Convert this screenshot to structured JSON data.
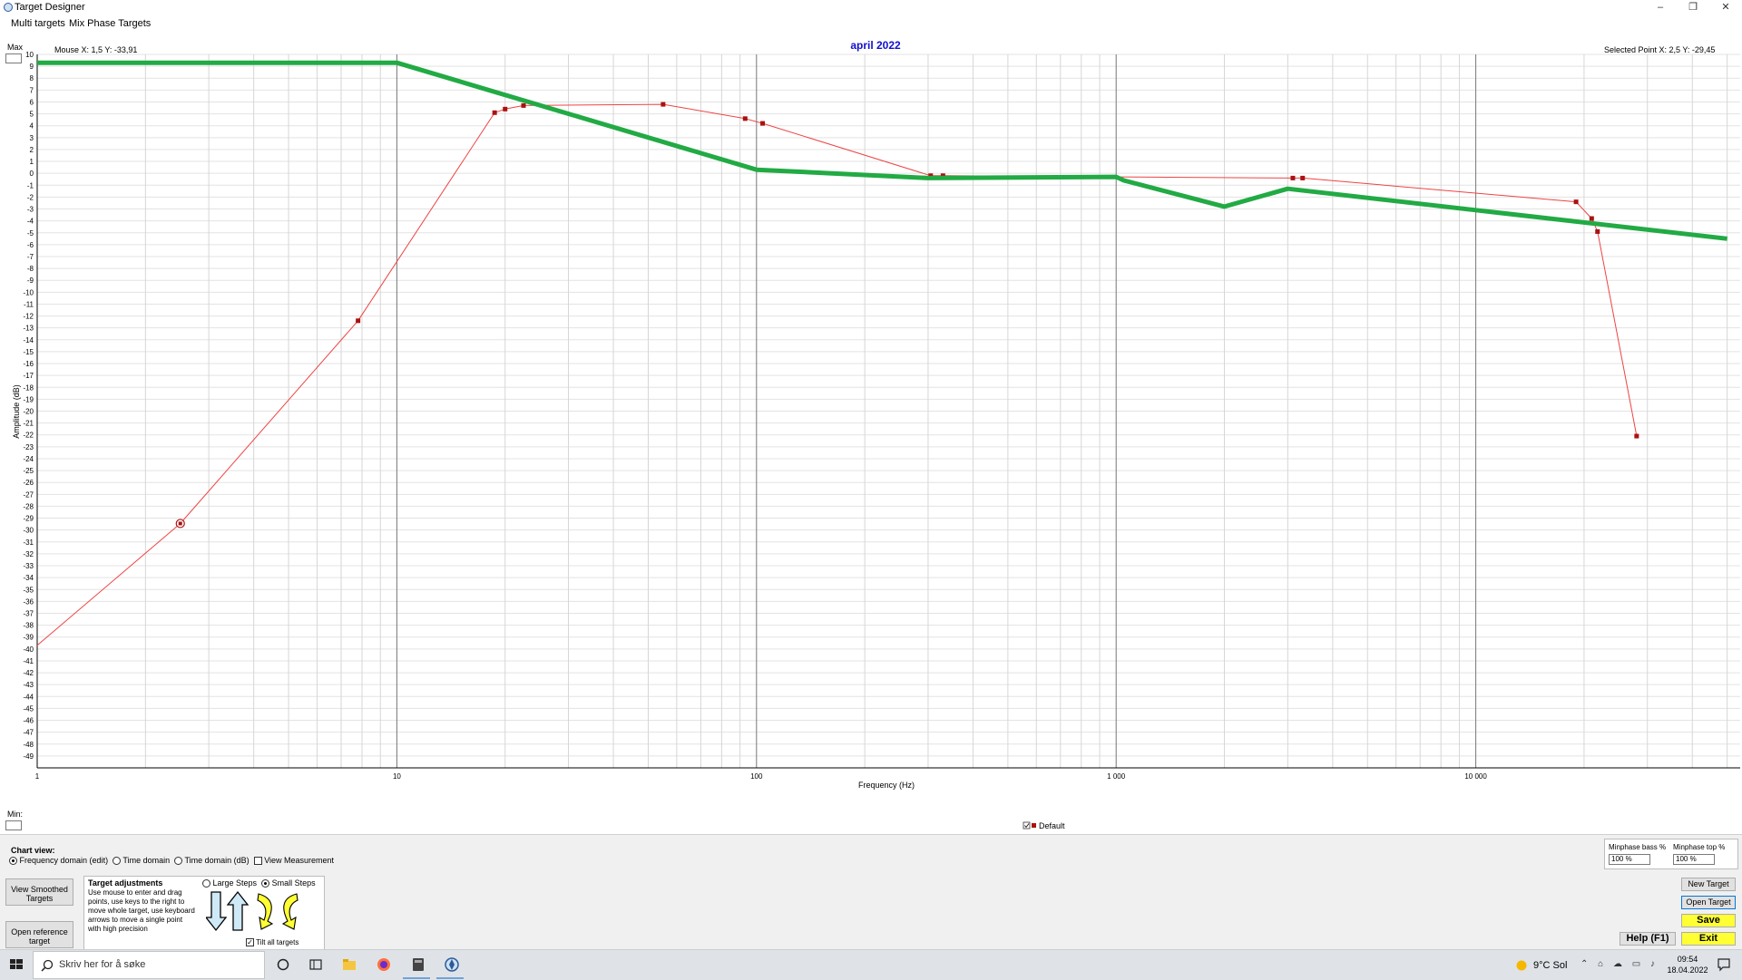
{
  "window": {
    "title": "Target Designer",
    "minimize": "–",
    "restore": "❐",
    "close": "✕"
  },
  "menu": [
    "Multi targets",
    "Mix Phase Targets"
  ],
  "chart_header": {
    "max_label": "Max",
    "min_label": "Min:",
    "mouse": "Mouse  X: 1,5   Y: -33,91",
    "selected": "Selected Point   X: 2,5   Y: -29,45"
  },
  "chart_data": {
    "type": "line",
    "title": "april 2022",
    "xlabel": "Frequency (Hz)",
    "ylabel": "Amplitude (dB)",
    "xscale": "log",
    "xlim": [
      1,
      50000
    ],
    "ylim": [
      -50,
      10
    ],
    "xticks": [
      {
        "v": 1,
        "label": "1"
      },
      {
        "v": 10,
        "label": "10"
      },
      {
        "v": 100,
        "label": "100"
      },
      {
        "v": 1000,
        "label": "1 000"
      },
      {
        "v": 10000,
        "label": "10 000"
      }
    ],
    "yticks": [
      10,
      9,
      8,
      7,
      6,
      5,
      4,
      3,
      2,
      1,
      0,
      -1,
      -2,
      -3,
      -4,
      -5,
      -6,
      -7,
      -8,
      -9,
      -10,
      -11,
      -12,
      -13,
      -14,
      -15,
      -16,
      -17,
      -18,
      -19,
      -20,
      -21,
      -22,
      -23,
      -24,
      -25,
      -26,
      -27,
      -28,
      -29,
      -30,
      -31,
      -32,
      -33,
      -34,
      -35,
      -36,
      -37,
      -38,
      -39,
      -40,
      -41,
      -42,
      -43,
      -44,
      -45,
      -46,
      -47,
      -48,
      -49
    ],
    "grid": true,
    "legend": {
      "position": "bottom",
      "entries": [
        "Default"
      ]
    },
    "series": [
      {
        "name": "Default",
        "color": "#ee4444",
        "marker": "square",
        "points": [
          [
            1,
            -39.7
          ],
          [
            2.5,
            -29.45
          ],
          [
            7.8,
            -12.4
          ],
          [
            18.7,
            5.1
          ],
          [
            20,
            5.4
          ],
          [
            22.5,
            5.7
          ],
          [
            55,
            5.8
          ],
          [
            93,
            4.6
          ],
          [
            104,
            4.2
          ],
          [
            305,
            -0.2
          ],
          [
            330,
            -0.2
          ],
          [
            3100,
            -0.4
          ],
          [
            3300,
            -0.4
          ],
          [
            19000,
            -2.4
          ],
          [
            21000,
            -3.8
          ],
          [
            21800,
            -4.9
          ],
          [
            28000,
            -22.1
          ]
        ],
        "selected_index": 1
      },
      {
        "color": "#22aa44",
        "marker": "none",
        "points": [
          [
            1,
            9.3
          ],
          [
            10,
            9.3
          ],
          [
            100,
            0.3
          ],
          [
            300,
            -0.4
          ],
          [
            1000,
            -0.3
          ],
          [
            1050,
            -0.6
          ],
          [
            2000,
            -2.8
          ],
          [
            3000,
            -1.3
          ],
          [
            10000,
            -3.1
          ],
          [
            50000,
            -5.5
          ]
        ]
      }
    ]
  },
  "bottom": {
    "chart_view": {
      "label": "Chart view:",
      "options": [
        "Frequency domain (edit)",
        "Time domain",
        "Time domain (dB)"
      ],
      "selected": 0,
      "view_measurement": "View Measurement"
    },
    "view_smoothed": "View Smoothed Targets",
    "open_reference": "Open reference target",
    "target_adjustments": {
      "title": "Target adjustments",
      "text": "Use mouse to enter and drag points, use keys to the right to move whole target, use keyboard arrows to move a single point with high precision",
      "large_steps": "Large Steps",
      "small_steps": "Small Steps",
      "tilt": "Tilt all targets"
    },
    "minphase": {
      "bass_label": "Minphase bass %",
      "bass_value": "100 %",
      "top_label": "Minphase top %",
      "top_value": "100 %"
    },
    "buttons": {
      "new_target": "New Target",
      "open_target": "Open Target",
      "save": "Save",
      "exit": "Exit",
      "help": "Help (F1)"
    }
  },
  "taskbar": {
    "search_placeholder": "Skriv her for å søke",
    "weather": "9°C  Sol",
    "time": "09:54",
    "date": "18.04.2022"
  },
  "colors": {
    "title": "#1010cc",
    "green_line": "#22aa44",
    "red_line": "#ee4444",
    "yellow_button": "#ffff33"
  }
}
